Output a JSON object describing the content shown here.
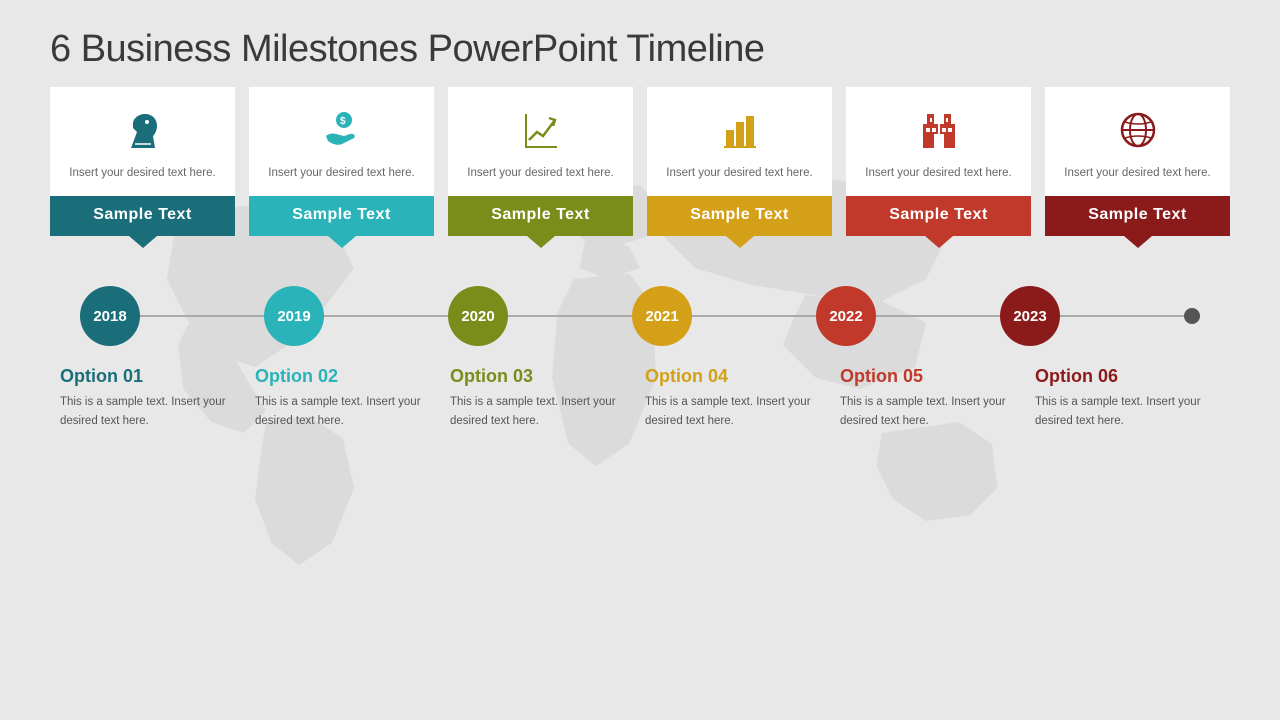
{
  "title": "6 Business Milestones PowerPoint Timeline",
  "cards": [
    {
      "id": "c1",
      "colorClass": "c1",
      "icon": "♞",
      "iconColor": "#1a6e7a",
      "bodyText": "Insert your desired text here.",
      "label": "Sample Text",
      "labelBg": "#1a6e7a"
    },
    {
      "id": "c2",
      "colorClass": "c2",
      "icon": "💰",
      "iconColor": "#2ab3b8",
      "bodyText": "Insert your desired text here.",
      "label": "Sample Text",
      "labelBg": "#2ab3b8"
    },
    {
      "id": "c3",
      "colorClass": "c3",
      "icon": "📈",
      "iconColor": "#7a8c1a",
      "bodyText": "Insert your desired text here.",
      "label": "Sample Text",
      "labelBg": "#7a8c1a"
    },
    {
      "id": "c4",
      "colorClass": "c4",
      "icon": "📊",
      "iconColor": "#d4a017",
      "bodyText": "Insert your desired text here.",
      "label": "Sample Text",
      "labelBg": "#d4a017"
    },
    {
      "id": "c5",
      "colorClass": "c5",
      "icon": "🏢",
      "iconColor": "#c0392b",
      "bodyText": "Insert your desired text here.",
      "label": "Sample Text",
      "labelBg": "#c0392b"
    },
    {
      "id": "c6",
      "colorClass": "c6",
      "icon": "🌐",
      "iconColor": "#8b1a1a",
      "bodyText": "Insert your desired text here.",
      "label": "Sample Text",
      "labelBg": "#8b1a1a"
    }
  ],
  "timeline": [
    {
      "year": "2018",
      "dotClass": "td1"
    },
    {
      "year": "2019",
      "dotClass": "td2"
    },
    {
      "year": "2020",
      "dotClass": "td3"
    },
    {
      "year": "2021",
      "dotClass": "td4"
    },
    {
      "year": "2022",
      "dotClass": "td5"
    },
    {
      "year": "2023",
      "dotClass": "td6"
    }
  ],
  "options": [
    {
      "titleClass": "ot1",
      "title": "Option 01",
      "text": "This is a sample text. Insert your desired text here."
    },
    {
      "titleClass": "ot2",
      "title": "Option 02",
      "text": "This is a sample text. Insert your desired text here."
    },
    {
      "titleClass": "ot3",
      "title": "Option 03",
      "text": "This is a sample text. Insert your desired text here."
    },
    {
      "titleClass": "ot4",
      "title": "Option 04",
      "text": "This is a sample text. Insert your desired text here."
    },
    {
      "titleClass": "ot5",
      "title": "Option 05",
      "text": "This is a sample text. Insert your desired text here."
    },
    {
      "titleClass": "ot6",
      "title": "Option 06",
      "text": "This is a sample text. Insert your desired text here."
    }
  ]
}
